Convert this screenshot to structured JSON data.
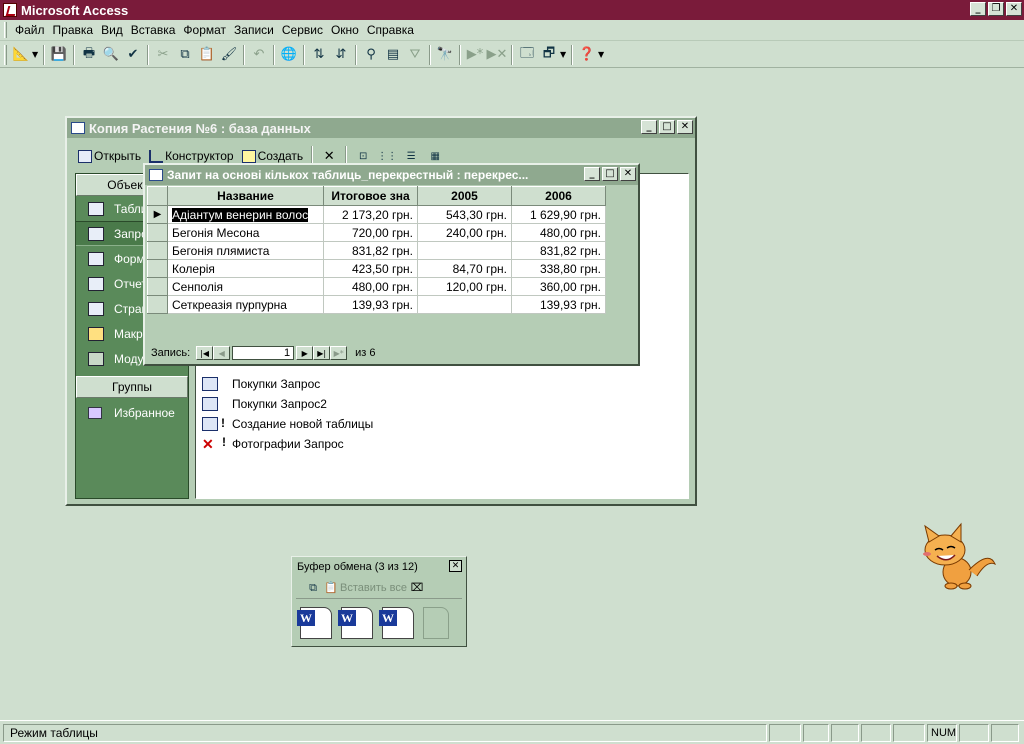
{
  "app": {
    "title": "Microsoft Access"
  },
  "menu": [
    "Файл",
    "Правка",
    "Вид",
    "Вставка",
    "Формат",
    "Записи",
    "Сервис",
    "Окно",
    "Справка"
  ],
  "db_window": {
    "title": "Копия Растения №6 : база данных",
    "toolbar": {
      "open": "Открыть",
      "design": "Конструктор",
      "create": "Создать"
    },
    "objects_header": "Объекты",
    "objects": [
      "Таблицы",
      "Запросы",
      "Формы",
      "Отчеты",
      "Страницы",
      "Макросы",
      "Модули"
    ],
    "groups_header": "Группы",
    "favorites": "Избранное",
    "list": [
      {
        "label": "Покупки Запрос",
        "icon": "select-query-icon"
      },
      {
        "label": "Покупки Запрос2",
        "icon": "select-query-icon"
      },
      {
        "label": "Создание новой таблицы",
        "icon": "make-table-query-icon"
      },
      {
        "label": "Фотографии Запрос",
        "icon": "delete-query-icon"
      }
    ]
  },
  "query_window": {
    "title": "Запит на основі кількох таблиць_перекрестный : перекрес...",
    "columns": [
      "Название",
      "Итоговое зна",
      "2005",
      "2006"
    ],
    "rows": [
      [
        "Адіантум венерин волос",
        "2 173,20 грн.",
        "543,30 грн.",
        "1 629,90 грн."
      ],
      [
        "Бегонія Месона",
        "720,00 грн.",
        "240,00 грн.",
        "480,00 грн."
      ],
      [
        "Бегонія плямиста",
        "831,82 грн.",
        "",
        "831,82 грн."
      ],
      [
        "Колерія",
        "423,50 грн.",
        "84,70 грн.",
        "338,80 грн."
      ],
      [
        "Сенполія",
        "480,00 грн.",
        "120,00 грн.",
        "360,00 грн."
      ],
      [
        "Сеткреазія пурпурна",
        "139,93 грн.",
        "",
        "139,93 грн."
      ]
    ],
    "record_label": "Запись:",
    "record_current": "1",
    "record_of": "из 6"
  },
  "clipboard": {
    "title": "Буфер обмена (3 из 12)",
    "paste_all": "Вставить все",
    "items": [
      "word-doc-icon",
      "word-doc-icon",
      "word-doc-icon",
      "empty-slot"
    ]
  },
  "status": {
    "text": "Режим таблицы",
    "num": "NUM"
  },
  "colors": {
    "titlebar": "#7a1b3a",
    "window_title": "#8fa98f",
    "desktop": "#cfdfcf",
    "objbar": "#5a8a5a"
  }
}
